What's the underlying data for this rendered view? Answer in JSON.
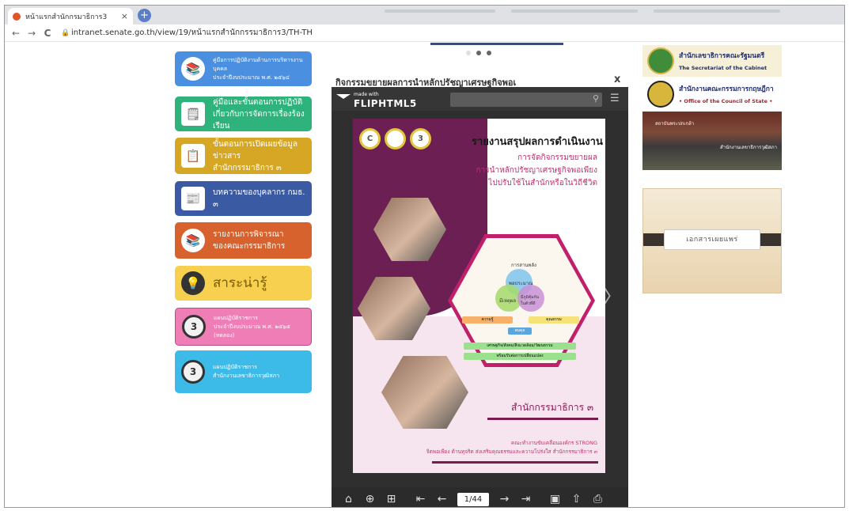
{
  "browser": {
    "tab_title": "หน้าแรกสำนักกรมาธิการ3",
    "tab_close": "×",
    "new_tab": "+",
    "back": "←",
    "forward": "→",
    "reload": "C",
    "url": "intranet.senate.go.th/view/19/หน้าแรกสำนักกรรมาธิการ3/TH-TH"
  },
  "left_menu": {
    "items": [
      {
        "label_1": "คู่มือการปฏิบัติงานด้านการบริหารงานบุคคล",
        "label_2": "ประจำปีงบประมาณ พ.ศ. ๒๕๖๔",
        "color": "#4a8fe0"
      },
      {
        "label_1": "คู่มือและขั้นตอนการปฏิบัติ",
        "label_2": "เกี่ยวกับการจัดการเรื่องร้องเรียน",
        "color": "#2db37b"
      },
      {
        "label_1": "ขั้นตอนการเปิดเผยข้อมูลข่าวสาร",
        "label_2": "สำนักกรรมาธิการ ๓",
        "color": "#d6a725"
      },
      {
        "label_1": "บทความของบุคลากร กมธ. ๓",
        "color": "#3a5aa3"
      },
      {
        "label_1": "รายงานการพิจารณา",
        "label_2": "ของคณะกรรมาธิการ",
        "color": "#d8622e"
      },
      {
        "label_1": "สาระน่ารู้",
        "color": "#f7d04f"
      },
      {
        "label_1": "แผนปฏิบัติราชการ",
        "label_2": "ประจำปีงบประมาณ พ.ศ. ๒๕๖๕",
        "label_3": "(ทดลอง)",
        "icon": "3",
        "color": "#ef7db6"
      },
      {
        "label_1": "แผนปฏิบัติราชการ",
        "label_2": "สำนักงานเลขาธิการวุฒิสภา",
        "icon": "3",
        "color": "#3dbbe8"
      }
    ]
  },
  "viewer": {
    "title": "กิจกรรมขยายผลการนำหลักปรัชญาเศรษฐกิจพอเ",
    "close": "x",
    "brand_made": "made with",
    "brand_name": "FLIPHTML5",
    "page_indicator": "1/44",
    "arrow_left": "〈",
    "arrow_right": "〉"
  },
  "document": {
    "title": "รายงานสรุปผลการดำเนินงาน",
    "sub_1": "การจัดกิจกรรมขยายผล",
    "sub_2": "การนำหลักปรัชญาเศรษฐกิจพอเพียง",
    "sub_3": "ไปปรับใช้ในสำนักหรือในวิถีชีวิต",
    "logo_c": "C",
    "logo_3": "3",
    "diagram_top": "การสานพลัง",
    "diagram_c1": "พอประมาณ",
    "diagram_c2": "มีเหตุผล",
    "diagram_c3": "มีภูมิคุ้มกันในตัวที่ดี",
    "diagram_r1": "ความรู้",
    "diagram_r2": "คุณธรรม",
    "diagram_bottom": "สมดุล",
    "diagram_b1": "เศรษฐกิจ/สังคม/สิ่งแวดล้อม/วัฒนธรรม",
    "diagram_b2": "พร้อมรับต่อการเปลี่ยนแปลง",
    "department": "สำนักกรรมาธิการ ๓",
    "footer_1": "คณะทำงานขับเคลื่อนองค์กร STRONG",
    "footer_2": "จิตพอเพียง ต้านทุจริต ส่งเสริมคุณธรรมและความโปร่งใส สำนักกรรมาธิการ ๓"
  },
  "right_sidebar": {
    "cabinet_th": "สำนักเลขาธิการคณะรัฐมนตรี",
    "cabinet_en": "The Secretariat of the Cabinet",
    "council_th": "สำนักงานคณะกรรมการกฤษฎีกา",
    "council_en": "• Office of the Council of State •",
    "photo_caption_1": "สถาบันพระปกเกล้า",
    "photo_caption_2": "สำนักงานเลขาธิการวุฒิสภา",
    "docs_label": "เอกสารเผยแพร่"
  },
  "colors": {
    "accent_plum": "#6b1f52",
    "accent_magenta": "#c21f6b",
    "viewer_dark": "#2f2f2f"
  }
}
